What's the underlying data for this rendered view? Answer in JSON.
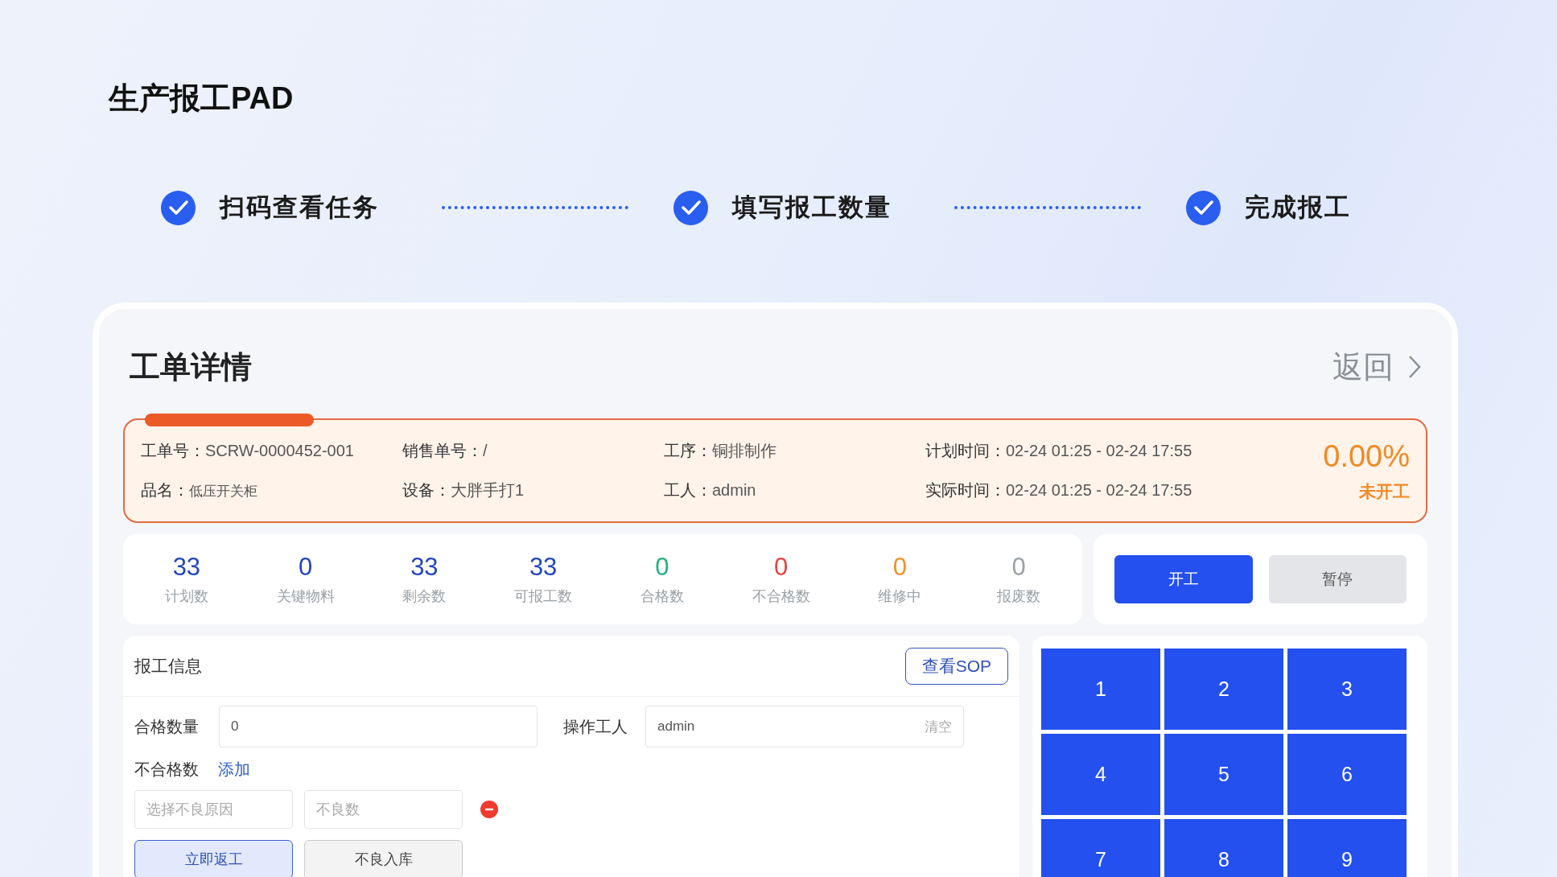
{
  "app_title": "生产报工PAD",
  "steps": [
    {
      "label": "扫码查看任务",
      "done": true
    },
    {
      "label": "填写报工数量",
      "done": true
    },
    {
      "label": "完成报工",
      "done": true
    }
  ],
  "order_panel": {
    "title": "工单详情",
    "back_link": "返回"
  },
  "order_info": {
    "fields": [
      {
        "label": "工单号：",
        "value": "SCRW-0000452-001"
      },
      {
        "label": "销售单号：",
        "value": "/"
      },
      {
        "label": "工序：",
        "value": "铜排制作"
      },
      {
        "label": "计划时间：",
        "value": "02-24 01:25 - 02-24 17:55"
      },
      {
        "label": "品名：",
        "value": "低压开关柜"
      },
      {
        "label": "设备：",
        "value": "大胖手打1"
      },
      {
        "label": "工人：",
        "value": "admin"
      },
      {
        "label": "实际时间：",
        "value": "02-24 01:25 - 02-24 17:55"
      }
    ],
    "progress": "0.00%",
    "status": "未开工"
  },
  "stats": [
    {
      "value": "33",
      "label": "计划数",
      "color": "#2346b8"
    },
    {
      "value": "0",
      "label": "关键物料",
      "color": "#2346b8"
    },
    {
      "value": "33",
      "label": "剩余数",
      "color": "#2346b8"
    },
    {
      "value": "33",
      "label": "可报工数",
      "color": "#2346b8"
    },
    {
      "value": "0",
      "label": "合格数",
      "color": "#1fb37a"
    },
    {
      "value": "0",
      "label": "不合格数",
      "color": "#e64242"
    },
    {
      "value": "0",
      "label": "维修中",
      "color": "#f0902a"
    },
    {
      "value": "0",
      "label": "报废数",
      "color": "#9aa0a6"
    }
  ],
  "actions": [
    {
      "label": "开工",
      "kind": "primary"
    },
    {
      "label": "暂停",
      "kind": "secondary"
    }
  ],
  "report": {
    "title": "报工信息",
    "sop_button": "查看SOP",
    "fields": [
      {
        "label": "合格数量",
        "value": "0"
      },
      {
        "label": "操作工人",
        "value": "admin",
        "clear": "清空"
      }
    ],
    "defect_label": "不合格数",
    "add_link": "添加",
    "defect_inputs": [
      {
        "placeholder": "选择不良原因"
      },
      {
        "placeholder": "不良数"
      }
    ],
    "buttons": [
      {
        "label": "立即返工",
        "selected": true
      },
      {
        "label": "不良入库",
        "selected": false
      }
    ]
  },
  "keypad": [
    "1",
    "2",
    "3",
    "4",
    "5",
    "6",
    "7",
    "8",
    "9"
  ]
}
